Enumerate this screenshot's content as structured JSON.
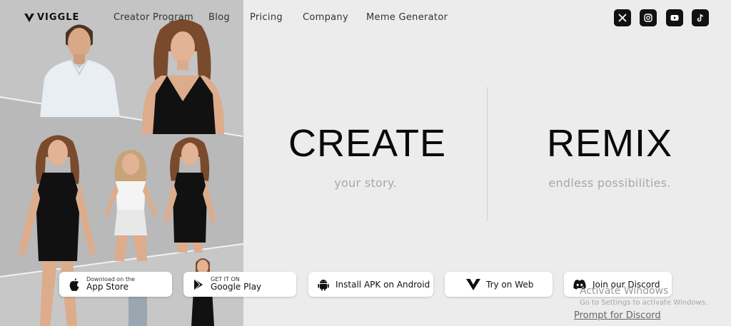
{
  "brand": {
    "name": "VIGGLE"
  },
  "nav": {
    "items": [
      {
        "label": "Creator Program"
      },
      {
        "label": "Blog"
      },
      {
        "label": "Pricing"
      },
      {
        "label": "Company"
      },
      {
        "label": "Meme Generator"
      }
    ]
  },
  "social": [
    {
      "icon": "x-icon"
    },
    {
      "icon": "instagram-icon"
    },
    {
      "icon": "youtube-icon"
    },
    {
      "icon": "tiktok-icon"
    }
  ],
  "hero": {
    "left": {
      "title": "CREATE",
      "subtitle": "your story."
    },
    "right": {
      "title": "REMIX",
      "subtitle": "endless possibilities."
    }
  },
  "downloads": {
    "app_store": {
      "small": "Download on the",
      "big": "App Store"
    },
    "google_play": {
      "small": "GET IT ON",
      "big": "Google Play"
    },
    "apk": {
      "label": "Install APK on Android"
    },
    "web": {
      "label": "Try on Web"
    },
    "discord": {
      "label": "Join our Discord"
    }
  },
  "prompt_link": "Prompt for Discord",
  "os_watermark": {
    "line1": "Activate Windows",
    "line2": "Go to Settings to activate Windows."
  },
  "colors": {
    "background": "#ececec",
    "text": "#0a0a0a",
    "muted": "#a8a8a8",
    "icon_tile": "#111111"
  }
}
